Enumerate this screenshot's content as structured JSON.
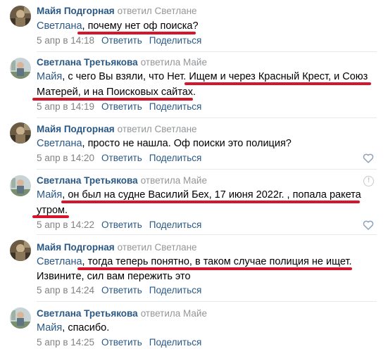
{
  "comments": [
    {
      "author": "Майя Подгорная",
      "verb": "ответил Светлане",
      "addressee": "Светлана",
      "text": ", почему нет оф поиска?",
      "date": "5 апр в 14:18",
      "reply": "Ответить",
      "share": "Поделиться"
    },
    {
      "author": "Светлана Третьякова",
      "verb": "ответила Майе",
      "addressee": "Майя",
      "line1": ", с чего Вы взяли, что Нет. Ищем и через Красный Крест, и Союз",
      "line2": "Матерей, и на Поисковых сайтах.",
      "date": "5 апр в 14:19",
      "reply": "Ответить",
      "share": "Поделиться"
    },
    {
      "author": "Майя Подгорная",
      "verb": "ответил Светлане",
      "addressee": "Светлана",
      "text": ", просто не нашла. Оф поиски это полиция?",
      "date": "5 апр в 14:20",
      "reply": "Ответить",
      "share": "Поделиться"
    },
    {
      "author": "Светлана Третьякова",
      "verb": "ответила Майе",
      "addressee": "Майя",
      "line1": ", он был на судне Василий Бех, 17 июня 2022г. , попала ракета",
      "line2": "утром.",
      "date": "5 апр в 14:22",
      "reply": "Ответить",
      "share": "Поделиться"
    },
    {
      "author": "Майя Подгорная",
      "verb": "ответил Светлане",
      "addressee": "Светлана",
      "line1": ", тогда теперь понятно, в таком случае полиция не ищет.",
      "line2": "Извините, сил вам пережить это",
      "date": "5 апр в 14:24",
      "reply": "Ответить",
      "share": "Поделиться"
    },
    {
      "author": "Светлана Третьякова",
      "verb": "ответила Майе",
      "addressee": "Майя",
      "text": ", спасибо.",
      "date": "5 апр в 14:25",
      "reply": "Ответить",
      "share": "Поделиться"
    }
  ],
  "icons": {
    "like": "heart-icon",
    "report": "warning-icon",
    "avatar": "avatar-image"
  },
  "colors": {
    "link": "#2a5885",
    "meta": "#828282",
    "underline": "#d4152b"
  }
}
